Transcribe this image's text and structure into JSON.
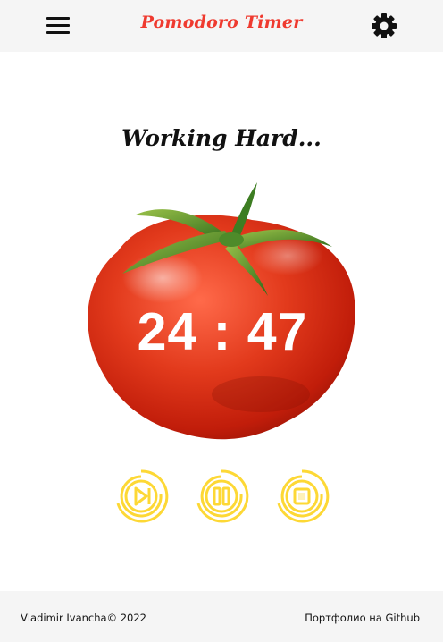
{
  "header": {
    "title": "Pomodoro Timer",
    "menu_icon": "hamburger-menu-icon",
    "settings_icon": "gear-icon"
  },
  "main": {
    "status": "Working Hard...",
    "timer": {
      "minutes": "24",
      "separator": ":",
      "seconds": "47",
      "display": "24 : 47"
    },
    "controls": [
      {
        "name": "start-button",
        "icon": "play-skip-icon"
      },
      {
        "name": "pause-button",
        "icon": "pause-icon"
      },
      {
        "name": "stop-button",
        "icon": "stop-icon"
      }
    ]
  },
  "footer": {
    "copyright": "Vladimir Ivancha© 2022",
    "portfolio_link": "Портфолио на Github"
  },
  "colors": {
    "accent": "#ef3a2f",
    "control": "#fdd835",
    "header_bg": "#f5f5f5",
    "footer_bg": "#f5f5f5"
  }
}
